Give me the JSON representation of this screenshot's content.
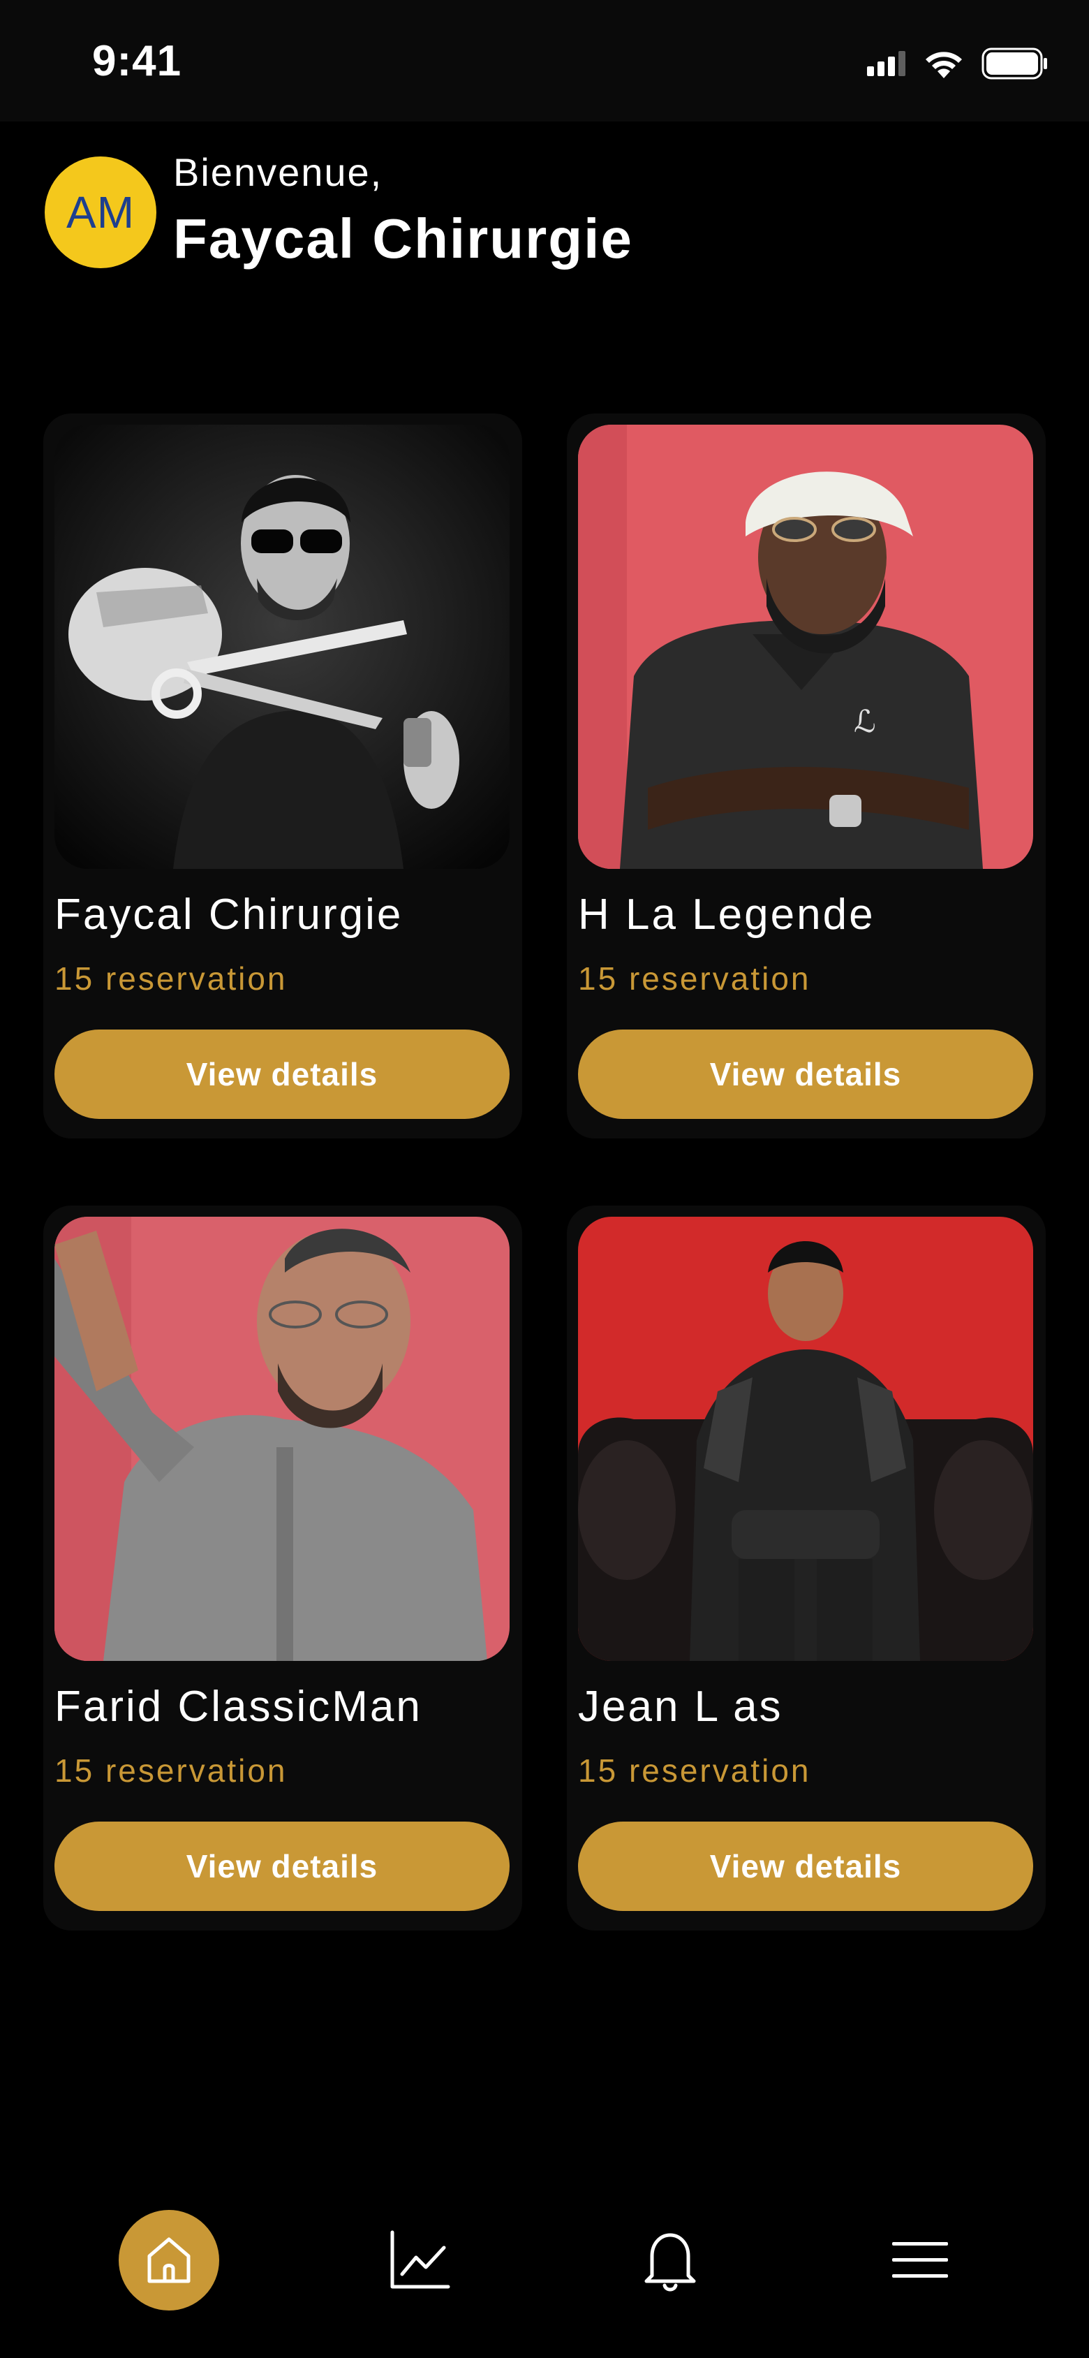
{
  "status_bar": {
    "time": "9:41"
  },
  "header": {
    "avatar_initials": "AM",
    "welcome": "Bienvenue,",
    "user_name": "Faycal Chirurgie"
  },
  "barbers": [
    {
      "name": "Faycal Chirurgie",
      "reservations": "15 reservation",
      "button": "View details"
    },
    {
      "name": "H La Legende",
      "reservations": "15 reservation",
      "button": "View details"
    },
    {
      "name": "Farid ClassicMan",
      "reservations": "15 reservation",
      "button": "View details"
    },
    {
      "name": "Jean L as",
      "reservations": "15 reservation",
      "button": "View details"
    }
  ],
  "bottom_nav": [
    {
      "icon": "home-icon",
      "active": true
    },
    {
      "icon": "chart-icon",
      "active": false
    },
    {
      "icon": "bell-icon",
      "active": false
    },
    {
      "icon": "menu-icon",
      "active": false
    }
  ],
  "colors": {
    "accent": "#c99836",
    "avatar_bg": "#f4c81c",
    "avatar_text": "#1e3f8e",
    "background": "#000000",
    "card_bg": "#0b0b0b"
  }
}
